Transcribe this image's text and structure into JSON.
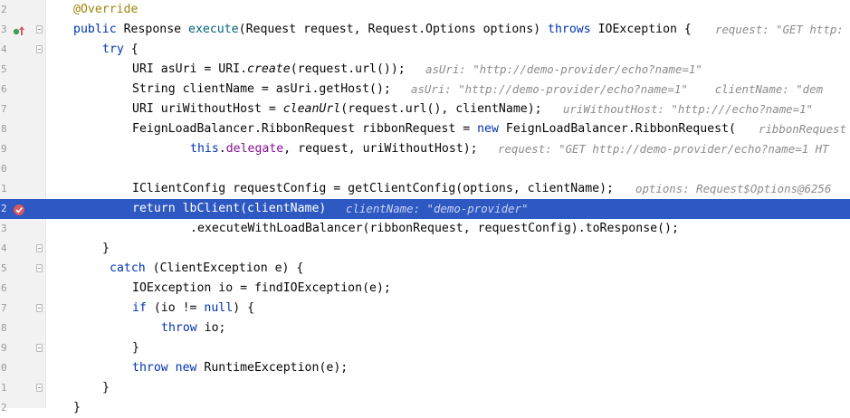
{
  "editor": {
    "line_numbers": [
      "2",
      "3",
      "4",
      "5",
      "6",
      "7",
      "8",
      "9",
      "0",
      "1",
      "2",
      "3",
      "4",
      "5",
      "6",
      "7",
      "8",
      "9",
      "0",
      "1",
      "2"
    ],
    "lines": [
      {
        "code": "@Override"
      },
      {
        "code": "public Response execute(Request request, Request.Options options) throws IOException {",
        "hint": "request: \"GET http:"
      },
      {
        "code": "try {"
      },
      {
        "code": "URI asUri = URI.create(request.url());",
        "hint": "asUri: \"http://demo-provider/echo?name=1\""
      },
      {
        "code": "String clientName = asUri.getHost();",
        "hint": "asUri: \"http://demo-provider/echo?name=1\"    clientName: \"dem"
      },
      {
        "code": "URI uriWithoutHost = cleanUrl(request.url(), clientName);",
        "hint": "uriWithoutHost: \"http:///echo?name=1\""
      },
      {
        "code": "FeignLoadBalancer.RibbonRequest ribbonRequest = new FeignLoadBalancer.RibbonRequest(",
        "hint": "ribbonRequest"
      },
      {
        "code": "this.delegate, request, uriWithoutHost);",
        "hint": "request: \"GET http://demo-provider/echo?name=1 HT"
      },
      {
        "code": ""
      },
      {
        "code": "IClientConfig requestConfig = getClientConfig(options, clientName);",
        "hint": "options: Request$Options@6256"
      },
      {
        "code": "return lbClient(clientName)",
        "hint": "clientName: \"demo-provider\""
      },
      {
        "code": ".executeWithLoadBalancer(ribbonRequest, requestConfig).toResponse();"
      },
      {
        "code": "}"
      },
      {
        "code": "catch (ClientException e) {"
      },
      {
        "code": "IOException io = findIOException(e);"
      },
      {
        "code": "if (io != null) {"
      },
      {
        "code": "throw io;"
      },
      {
        "code": "}"
      },
      {
        "code": "throw new RuntimeException(e);"
      },
      {
        "code": "}"
      },
      {
        "code": "}"
      }
    ],
    "selected_line_index": 10
  },
  "icons": {
    "override_marker": "override-up-arrow-icon",
    "breakpoint_marker": "breakpoint-icon",
    "fold_marker": "fold-icon"
  },
  "colors": {
    "selection": "#2f59c2",
    "keyword": "#0033b3",
    "annotation": "#9e880d",
    "hint": "#8c8c8c",
    "breakpoint": "#db5860"
  }
}
